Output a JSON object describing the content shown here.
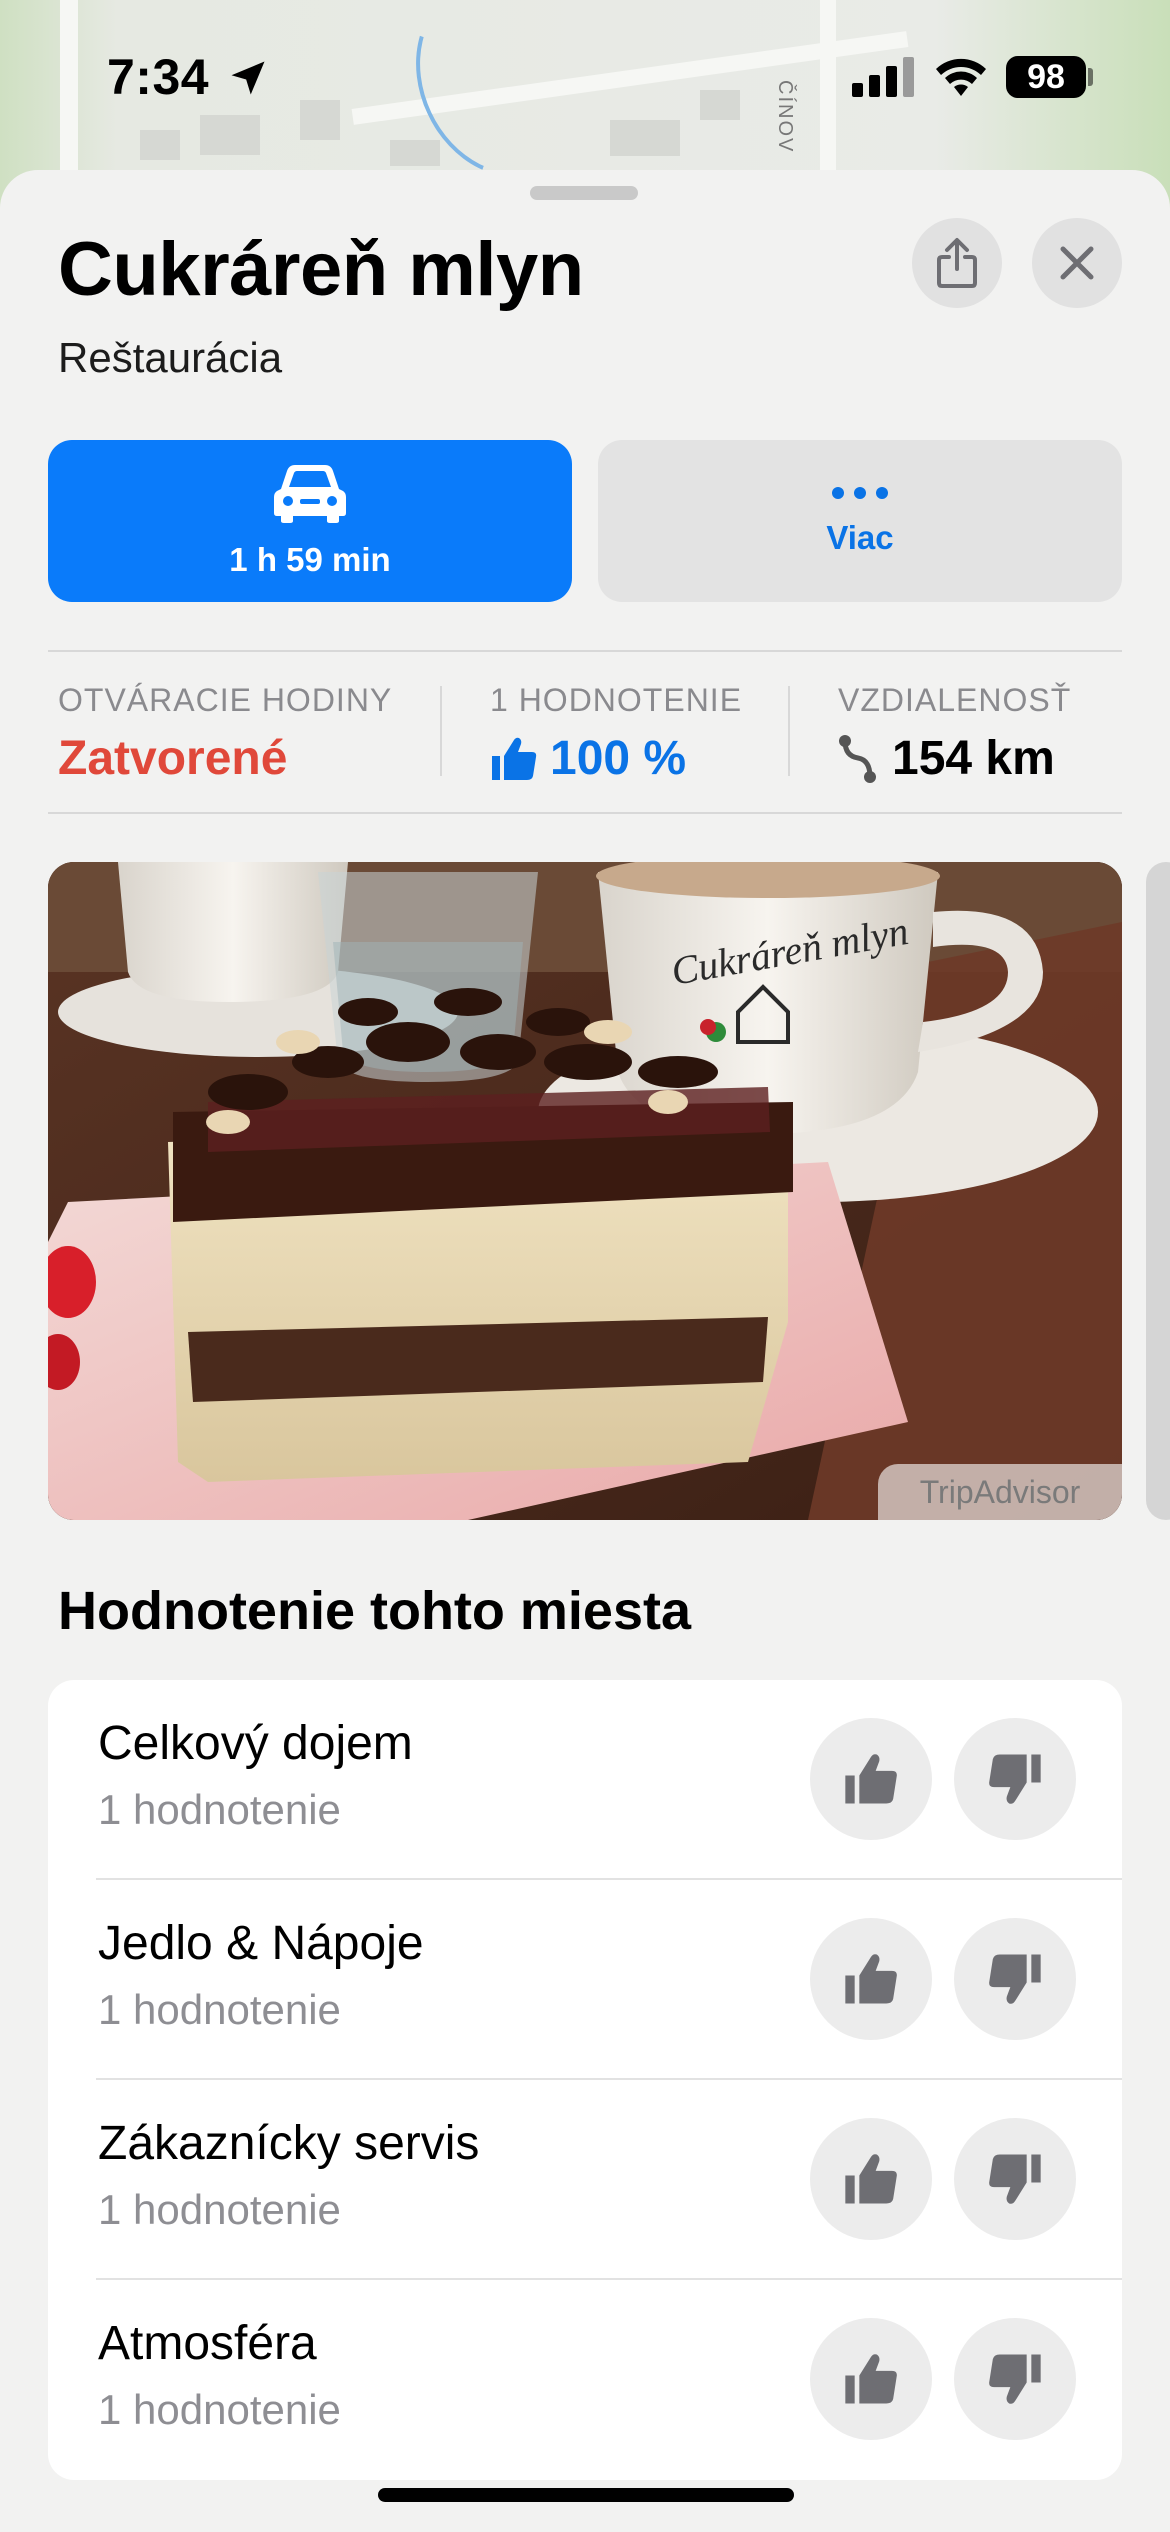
{
  "status_bar": {
    "time": "7:34",
    "battery": "98",
    "icons": [
      "location-arrow-icon",
      "cellular-signal-icon",
      "wifi-icon",
      "battery-icon"
    ]
  },
  "map": {
    "street_label": "ČÍNOV"
  },
  "place": {
    "title": "Cukráreň mlyn",
    "subtitle": "Reštaurácia"
  },
  "actions": {
    "drive": {
      "label": "1 h 59 min",
      "icon": "car-icon"
    },
    "more": {
      "label": "Viac",
      "icon": "ellipsis-icon"
    }
  },
  "stats": {
    "hours": {
      "label": "OTVÁRACIE HODINY",
      "value": "Zatvorené"
    },
    "rating": {
      "label": "1 HODNOTENIE",
      "value": "100 %",
      "icon": "thumbs-up-icon"
    },
    "distance": {
      "label": "VZDIALENOSŤ",
      "value": "154 km",
      "icon": "route-icon"
    }
  },
  "photo": {
    "source": "TripAdvisor",
    "cup_text": "Cukráreň mlyn"
  },
  "ratings_section": {
    "title": "Hodnotenie tohto miesta",
    "rows": [
      {
        "name": "Celkový dojem",
        "count": "1 hodnotenie"
      },
      {
        "name": "Jedlo & Nápoje",
        "count": "1 hodnotenie"
      },
      {
        "name": "Zákaznícky servis",
        "count": "1 hodnotenie"
      },
      {
        "name": "Atmosféra",
        "count": "1 hodnotenie"
      }
    ]
  },
  "colors": {
    "accent": "#0A7BFA",
    "closed": "#E0483A",
    "secondary_text": "#8E8E93",
    "sheet_background": "#F2F2F1"
  }
}
